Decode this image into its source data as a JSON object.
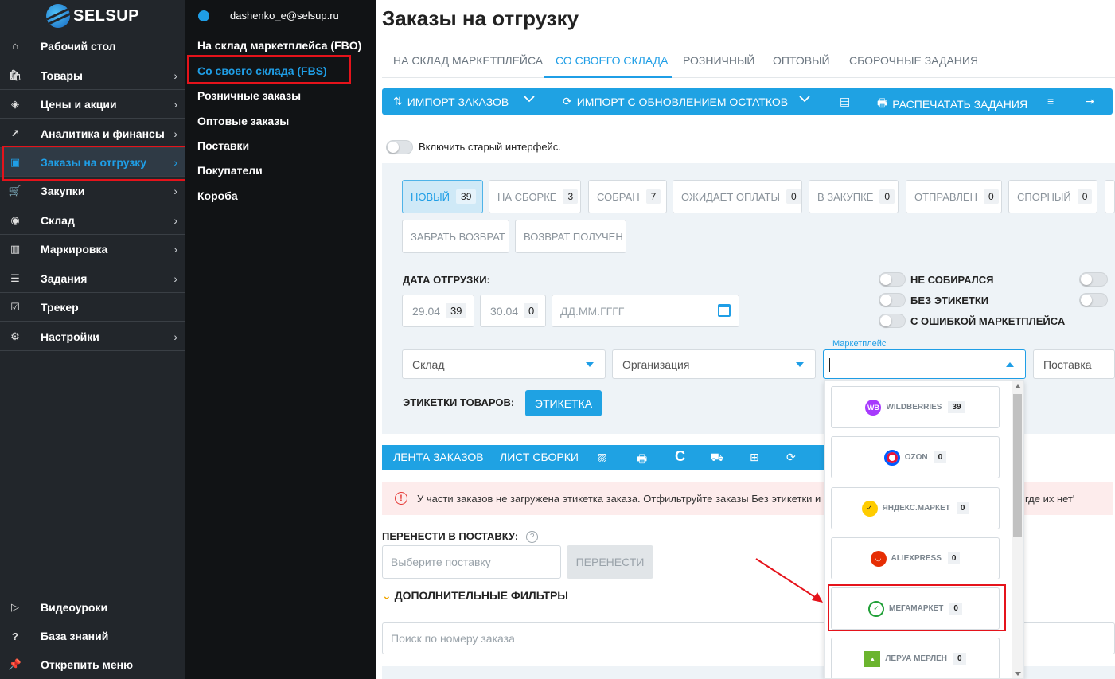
{
  "app": {
    "brand": "SELSUP"
  },
  "sidebar": {
    "items": [
      {
        "label": "Рабочий стол",
        "icon": "home-icon",
        "chevron": ""
      },
      {
        "label": "Товары",
        "icon": "bag-icon",
        "chevron": "›"
      },
      {
        "label": "Цены и акции",
        "icon": "tag-icon",
        "chevron": "›"
      },
      {
        "label": "Аналитика и финансы",
        "icon": "chart-icon",
        "chevron": "›"
      },
      {
        "label": "Заказы на отгрузку",
        "icon": "box-icon",
        "chevron": "›"
      },
      {
        "label": "Закупки",
        "icon": "cart-icon",
        "chevron": "›"
      },
      {
        "label": "Склад",
        "icon": "check-circle-icon",
        "chevron": "›"
      },
      {
        "label": "Маркировка",
        "icon": "barcode-icon",
        "chevron": "›"
      },
      {
        "label": "Задания",
        "icon": "tasks-icon",
        "chevron": "›"
      },
      {
        "label": "Трекер",
        "icon": "calendar-check-icon",
        "chevron": ""
      },
      {
        "label": "Настройки",
        "icon": "gear-icon",
        "chevron": "›"
      }
    ],
    "bottom": [
      {
        "label": "Видеоуроки",
        "icon": "play-icon"
      },
      {
        "label": "База знаний",
        "icon": "question-icon"
      },
      {
        "label": "Открепить меню",
        "icon": "pin-icon"
      }
    ],
    "active_color": "#1f9ee6"
  },
  "submenu": {
    "user": "dashenko_e@selsup.ru",
    "items": [
      "На склад маркетплейса (FBO)",
      "Со своего склада (FBS)",
      "Розничные заказы",
      "Оптовые заказы",
      "Поставки",
      "Покупатели",
      "Короба"
    ]
  },
  "main": {
    "title": "Заказы на отгрузку",
    "tabs": [
      "НА СКЛАД МАРКЕТПЛЕЙСА",
      "СО СВОЕГО СКЛАДА",
      "РОЗНИЧНЫЙ",
      "ОПТОВЫЙ",
      "СБОРОЧНЫЕ ЗАДАНИЯ"
    ],
    "toolbar": {
      "import": "ИМПОРТ ЗАКАЗОВ",
      "import_update": "ИМПОРТ С ОБНОВЛЕНИЕМ ОСТАТКОВ",
      "print": "РАСПЕЧАТАТЬ ЗАДАНИЯ"
    },
    "old_ui_toggle": "Включить старый интерфейс.",
    "statuses": [
      {
        "label": "НОВЫЙ",
        "count": "39"
      },
      {
        "label": "НА СБОРКЕ",
        "count": "3"
      },
      {
        "label": "СОБРАН",
        "count": "7"
      },
      {
        "label": "ОЖИДАЕТ ОПЛАТЫ",
        "count": "0"
      },
      {
        "label": "В ЗАКУПКЕ",
        "count": "0"
      },
      {
        "label": "ОТПРАВЛЕН",
        "count": "0"
      },
      {
        "label": "СПОРНЫЙ",
        "count": "0"
      }
    ],
    "statuses_row2": [
      "ЗАБРАТЬ ВОЗВРАТ",
      "ВОЗВРАТ ПОЛУЧЕН"
    ],
    "ship_date_label": "ДАТА ОТГРУЗКИ:",
    "dates": [
      {
        "date": "29.04",
        "count": "39"
      },
      {
        "date": "30.04",
        "count": "0"
      }
    ],
    "date_placeholder": "ДД.ММ.ГГГГ",
    "switches": [
      "НЕ СОБИРАЛСЯ",
      "БЕЗ ЭТИКЕТКИ",
      "С ОШИБКОЙ МАРКЕТПЛЕЙСА"
    ],
    "selects": {
      "warehouse": "Склад",
      "organization": "Организация",
      "marketplace_label": "Маркетплейс",
      "supply": "Поставка"
    },
    "labels_title": "ЭТИКЕТКИ ТОВАРОВ:",
    "label_button": "ЭТИКЕТКА",
    "bar2": {
      "feed": "ЛЕНТА ЗАКАЗОВ",
      "sheet": "ЛИСТ СБОРКИ"
    },
    "alert": {
      "text": "У части заказов не загружена этикетка заказа. Отфильтруйте заказы Без этикетки и наж",
      "tail": "где их нет'"
    },
    "transfer_label": "ПЕРЕНЕСТИ В ПОСТАВКУ:",
    "transfer_placeholder": "Выберите поставку",
    "transfer_button": "ПЕРЕНЕСТИ",
    "extra_filters": "ДОПОЛНИТЕЛЬНЫЕ ФИЛЬТРЫ",
    "search_placeholder": "Поиск по номеру заказа"
  },
  "marketplaces": [
    {
      "name": "WILDBERRIES",
      "count": "39",
      "color": "#a73afd",
      "abbr": "WB"
    },
    {
      "name": "OZON",
      "count": "0",
      "color": "#005bff",
      "abbr": ""
    },
    {
      "name": "ЯНДЕКС.МАРКЕТ",
      "count": "0",
      "color": "#ffcc00",
      "abbr": ""
    },
    {
      "name": "ALIEXPRESS",
      "count": "0",
      "color": "#e62e04",
      "abbr": ""
    },
    {
      "name": "МЕГАМАРКЕТ",
      "count": "0",
      "color": "#21a038",
      "abbr": ""
    },
    {
      "name": "ЛЕРУА МЕРЛЕН",
      "count": "0",
      "color": "#6bb42e",
      "abbr": ""
    }
  ],
  "highlight_color": "#e5131b"
}
